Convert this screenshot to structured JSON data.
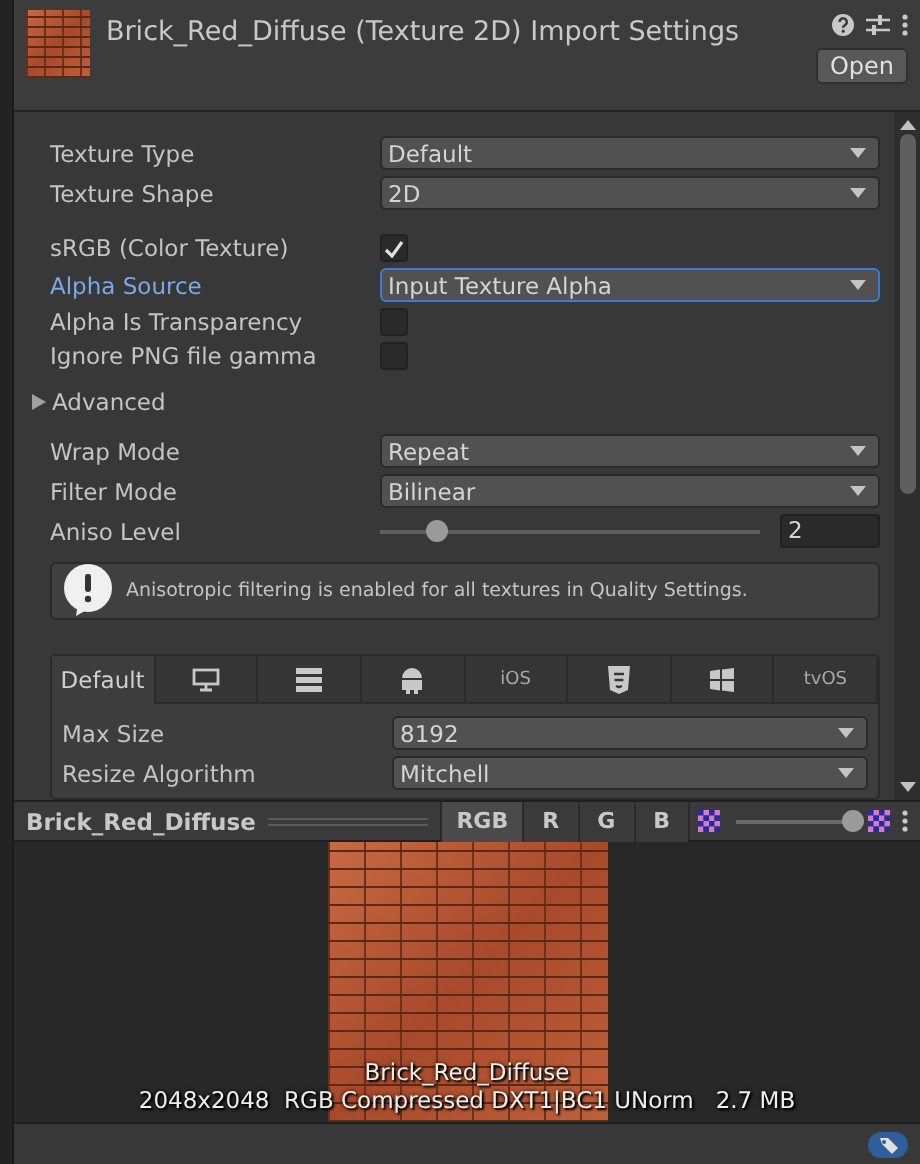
{
  "header": {
    "title": "Brick_Red_Diffuse (Texture 2D) Import Settings",
    "open_button": "Open"
  },
  "fields": [
    {
      "kind": "dropdown",
      "label": "Texture Type",
      "value": "Default",
      "focused": false
    },
    {
      "kind": "dropdown",
      "label": "Texture Shape",
      "value": "2D",
      "focused": false
    },
    {
      "kind": "gap"
    },
    {
      "kind": "checkbox",
      "label": "sRGB (Color Texture)",
      "checked": true
    },
    {
      "kind": "dropdown",
      "label": "Alpha Source",
      "value": "Input Texture Alpha",
      "focused": true
    },
    {
      "kind": "checkbox",
      "label": "Alpha Is Transparency",
      "checked": false
    },
    {
      "kind": "checkbox",
      "label": "Ignore PNG file gamma",
      "checked": false
    }
  ],
  "advanced": {
    "label": "Advanced",
    "expanded": false
  },
  "sampling": [
    {
      "kind": "dropdown",
      "label": "Wrap Mode",
      "value": "Repeat",
      "focused": false
    },
    {
      "kind": "dropdown",
      "label": "Filter Mode",
      "value": "Bilinear",
      "focused": false
    },
    {
      "kind": "slider",
      "label": "Aniso Level",
      "level": 0.13,
      "value": "2"
    }
  ],
  "help_box": {
    "message": "Anisotropic filtering is enabled for all textures in Quality Settings."
  },
  "platform_tabs": [
    {
      "kind": "text",
      "label": "Default",
      "selected": true
    },
    {
      "kind": "icon",
      "selected": false
    },
    {
      "kind": "icon",
      "selected": false
    },
    {
      "kind": "icon",
      "selected": false
    },
    {
      "kind": "text",
      "label": "iOS",
      "selected": false
    },
    {
      "kind": "icon",
      "selected": false
    },
    {
      "kind": "icon",
      "selected": false
    },
    {
      "kind": "text",
      "label": "tvOS",
      "selected": false
    }
  ],
  "platform_fields": [
    {
      "kind": "dropdown",
      "label": "Max Size",
      "value": "8192",
      "focused": false
    },
    {
      "kind": "dropdown",
      "label": "Resize Algorithm",
      "value": "Mitchell",
      "focused": false
    }
  ],
  "preview": {
    "title": "Brick_Red_Diffuse",
    "channels": [
      {
        "label": "RGB",
        "selected": true
      },
      {
        "label": "R",
        "selected": false
      },
      {
        "label": "G",
        "selected": false
      },
      {
        "label": "B",
        "selected": false
      }
    ],
    "level": 1.0,
    "name": "Brick_Red_Diffuse",
    "info": "2048x2048  RGB Compressed DXT1|BC1 UNorm   2.7 MB"
  }
}
